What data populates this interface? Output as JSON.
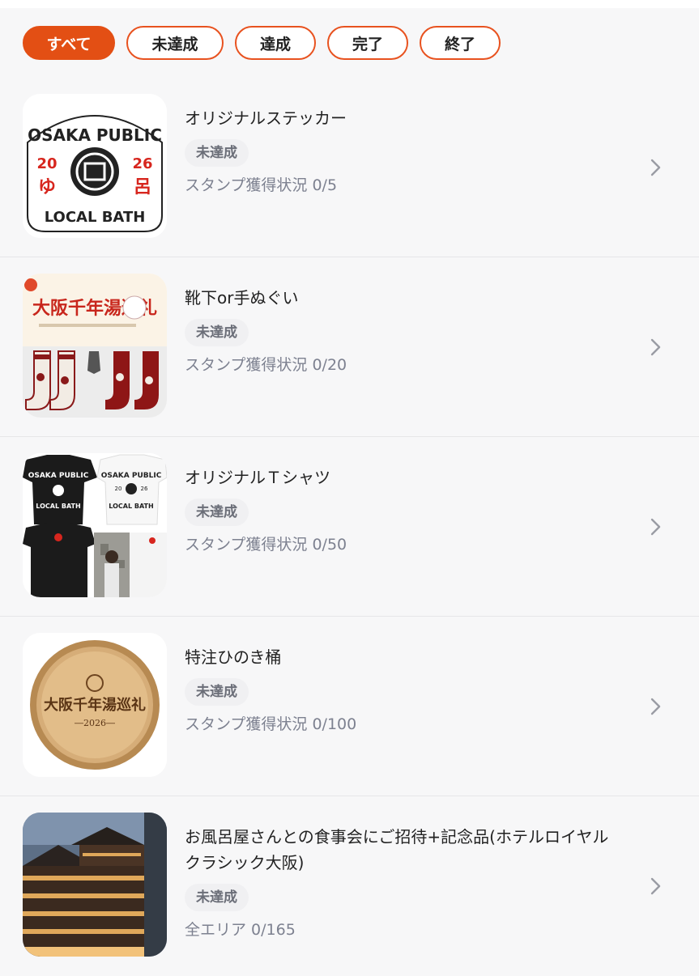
{
  "filters": [
    {
      "label": "すべて",
      "active": true
    },
    {
      "label": "未達成",
      "active": false
    },
    {
      "label": "達成",
      "active": false
    },
    {
      "label": "完了",
      "active": false
    },
    {
      "label": "終了",
      "active": false
    }
  ],
  "items": [
    {
      "title": "オリジナルステッカー",
      "status": "未達成",
      "progress": "スタンプ獲得状況 0/5",
      "thumb_text": {
        "top": "OSAKA PUBLIC",
        "bottom": "LOCAL BATH",
        "left_top": "20",
        "right_top": "26",
        "left_glyph": "ゆ",
        "right_glyph": "呂"
      }
    },
    {
      "title": "靴下or手ぬぐい",
      "status": "未達成",
      "progress": "スタンプ獲得状況 0/20",
      "thumb_text": {
        "banner": "大阪千年湯巡礼"
      }
    },
    {
      "title": "オリジナルＴシャツ",
      "status": "未達成",
      "progress": "スタンプ獲得状況 0/50",
      "thumb_text": {
        "shirt_top": "OSAKA PUBLIC",
        "shirt_mid_left": "20",
        "shirt_mid_right": "26",
        "shirt_bottom": "LOCAL BATH"
      }
    },
    {
      "title": "特注ひのき桶",
      "status": "未達成",
      "progress": "スタンプ獲得状況 0/100",
      "thumb_text": {
        "main": "大阪千年湯巡礼",
        "year": "―2026―"
      }
    },
    {
      "title": "お風呂屋さんとの食事会にご招待+記念品(ホテルロイヤルクラシック大阪)",
      "status": "未達成",
      "progress": "全エリア 0/165",
      "thumb_text": {}
    }
  ],
  "colors": {
    "accent": "#e34f14",
    "badge_bg": "#f0f0f2",
    "muted": "#7d8190"
  },
  "icons": {
    "row_chevron": "chevron-right-icon"
  }
}
